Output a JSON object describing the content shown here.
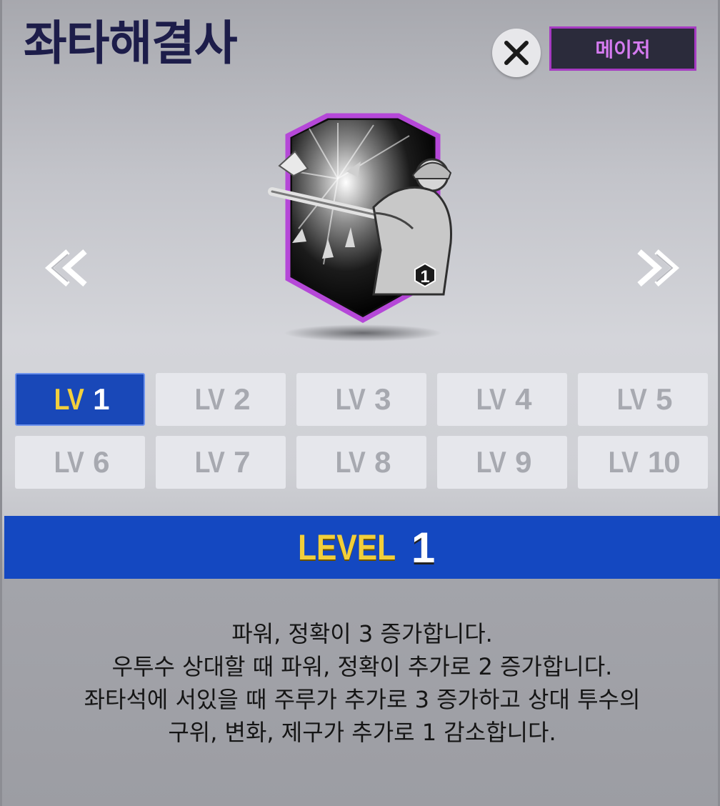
{
  "header": {
    "title": "좌타해결사",
    "tag_label": "메이저"
  },
  "badge": {
    "level_marker": "1"
  },
  "levels": [
    {
      "prefix": "LV",
      "num": "1"
    },
    {
      "prefix": "LV",
      "num": "2"
    },
    {
      "prefix": "LV",
      "num": "3"
    },
    {
      "prefix": "LV",
      "num": "4"
    },
    {
      "prefix": "LV",
      "num": "5"
    },
    {
      "prefix": "LV",
      "num": "6"
    },
    {
      "prefix": "LV",
      "num": "7"
    },
    {
      "prefix": "LV",
      "num": "8"
    },
    {
      "prefix": "LV",
      "num": "9"
    },
    {
      "prefix": "LV",
      "num": "10"
    }
  ],
  "selected_level": {
    "word": "LEVEL",
    "number": "1"
  },
  "description": [
    "파워, 정확이 3 증가합니다.",
    "우투수 상대할 때 파워, 정확이 추가로 2 증가합니다.",
    "좌타석에 서있을 때 주루가 추가로 3 증가하고 상대 투수의",
    "구위, 변화, 제구가 추가로 1 감소합니다."
  ],
  "colors": {
    "accent": "#1448c1",
    "gold": "#f2cf3a",
    "tag_border": "#a63bc2",
    "title": "#1d1d4a"
  }
}
